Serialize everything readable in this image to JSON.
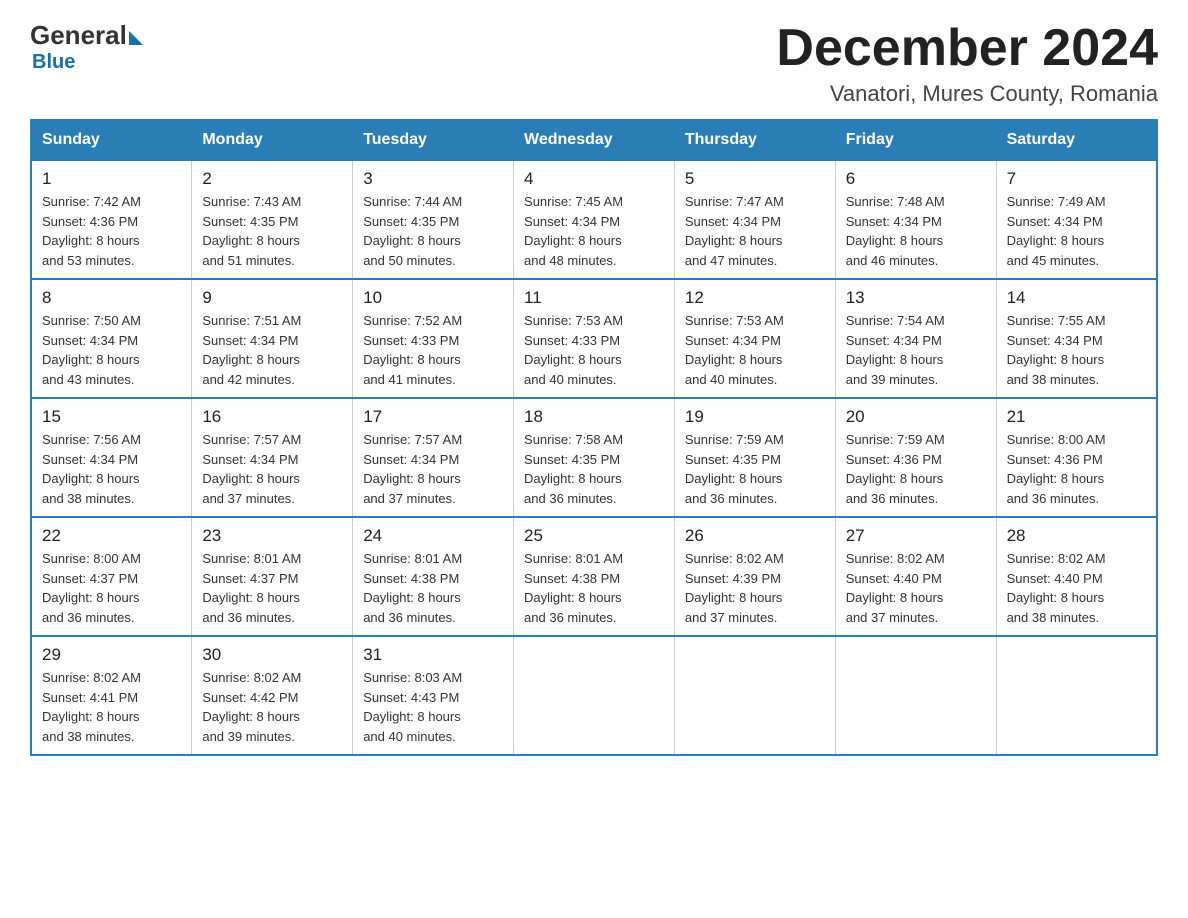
{
  "header": {
    "logo_general": "General",
    "logo_blue": "Blue",
    "month_year": "December 2024",
    "location": "Vanatori, Mures County, Romania"
  },
  "days_of_week": [
    "Sunday",
    "Monday",
    "Tuesday",
    "Wednesday",
    "Thursday",
    "Friday",
    "Saturday"
  ],
  "weeks": [
    [
      {
        "num": "1",
        "sunrise": "7:42 AM",
        "sunset": "4:36 PM",
        "daylight": "8 hours and 53 minutes."
      },
      {
        "num": "2",
        "sunrise": "7:43 AM",
        "sunset": "4:35 PM",
        "daylight": "8 hours and 51 minutes."
      },
      {
        "num": "3",
        "sunrise": "7:44 AM",
        "sunset": "4:35 PM",
        "daylight": "8 hours and 50 minutes."
      },
      {
        "num": "4",
        "sunrise": "7:45 AM",
        "sunset": "4:34 PM",
        "daylight": "8 hours and 48 minutes."
      },
      {
        "num": "5",
        "sunrise": "7:47 AM",
        "sunset": "4:34 PM",
        "daylight": "8 hours and 47 minutes."
      },
      {
        "num": "6",
        "sunrise": "7:48 AM",
        "sunset": "4:34 PM",
        "daylight": "8 hours and 46 minutes."
      },
      {
        "num": "7",
        "sunrise": "7:49 AM",
        "sunset": "4:34 PM",
        "daylight": "8 hours and 45 minutes."
      }
    ],
    [
      {
        "num": "8",
        "sunrise": "7:50 AM",
        "sunset": "4:34 PM",
        "daylight": "8 hours and 43 minutes."
      },
      {
        "num": "9",
        "sunrise": "7:51 AM",
        "sunset": "4:34 PM",
        "daylight": "8 hours and 42 minutes."
      },
      {
        "num": "10",
        "sunrise": "7:52 AM",
        "sunset": "4:33 PM",
        "daylight": "8 hours and 41 minutes."
      },
      {
        "num": "11",
        "sunrise": "7:53 AM",
        "sunset": "4:33 PM",
        "daylight": "8 hours and 40 minutes."
      },
      {
        "num": "12",
        "sunrise": "7:53 AM",
        "sunset": "4:34 PM",
        "daylight": "8 hours and 40 minutes."
      },
      {
        "num": "13",
        "sunrise": "7:54 AM",
        "sunset": "4:34 PM",
        "daylight": "8 hours and 39 minutes."
      },
      {
        "num": "14",
        "sunrise": "7:55 AM",
        "sunset": "4:34 PM",
        "daylight": "8 hours and 38 minutes."
      }
    ],
    [
      {
        "num": "15",
        "sunrise": "7:56 AM",
        "sunset": "4:34 PM",
        "daylight": "8 hours and 38 minutes."
      },
      {
        "num": "16",
        "sunrise": "7:57 AM",
        "sunset": "4:34 PM",
        "daylight": "8 hours and 37 minutes."
      },
      {
        "num": "17",
        "sunrise": "7:57 AM",
        "sunset": "4:34 PM",
        "daylight": "8 hours and 37 minutes."
      },
      {
        "num": "18",
        "sunrise": "7:58 AM",
        "sunset": "4:35 PM",
        "daylight": "8 hours and 36 minutes."
      },
      {
        "num": "19",
        "sunrise": "7:59 AM",
        "sunset": "4:35 PM",
        "daylight": "8 hours and 36 minutes."
      },
      {
        "num": "20",
        "sunrise": "7:59 AM",
        "sunset": "4:36 PM",
        "daylight": "8 hours and 36 minutes."
      },
      {
        "num": "21",
        "sunrise": "8:00 AM",
        "sunset": "4:36 PM",
        "daylight": "8 hours and 36 minutes."
      }
    ],
    [
      {
        "num": "22",
        "sunrise": "8:00 AM",
        "sunset": "4:37 PM",
        "daylight": "8 hours and 36 minutes."
      },
      {
        "num": "23",
        "sunrise": "8:01 AM",
        "sunset": "4:37 PM",
        "daylight": "8 hours and 36 minutes."
      },
      {
        "num": "24",
        "sunrise": "8:01 AM",
        "sunset": "4:38 PM",
        "daylight": "8 hours and 36 minutes."
      },
      {
        "num": "25",
        "sunrise": "8:01 AM",
        "sunset": "4:38 PM",
        "daylight": "8 hours and 36 minutes."
      },
      {
        "num": "26",
        "sunrise": "8:02 AM",
        "sunset": "4:39 PM",
        "daylight": "8 hours and 37 minutes."
      },
      {
        "num": "27",
        "sunrise": "8:02 AM",
        "sunset": "4:40 PM",
        "daylight": "8 hours and 37 minutes."
      },
      {
        "num": "28",
        "sunrise": "8:02 AM",
        "sunset": "4:40 PM",
        "daylight": "8 hours and 38 minutes."
      }
    ],
    [
      {
        "num": "29",
        "sunrise": "8:02 AM",
        "sunset": "4:41 PM",
        "daylight": "8 hours and 38 minutes."
      },
      {
        "num": "30",
        "sunrise": "8:02 AM",
        "sunset": "4:42 PM",
        "daylight": "8 hours and 39 minutes."
      },
      {
        "num": "31",
        "sunrise": "8:03 AM",
        "sunset": "4:43 PM",
        "daylight": "8 hours and 40 minutes."
      },
      null,
      null,
      null,
      null
    ]
  ],
  "labels": {
    "sunrise": "Sunrise:",
    "sunset": "Sunset:",
    "daylight": "Daylight:"
  }
}
